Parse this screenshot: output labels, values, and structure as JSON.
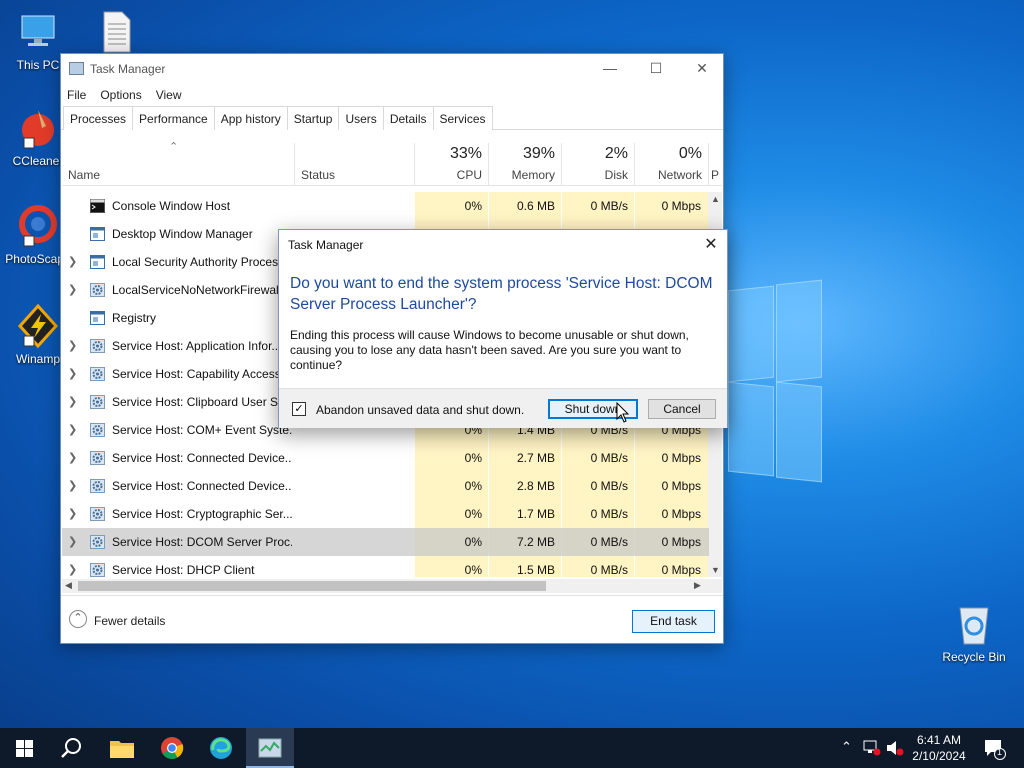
{
  "desktop": {
    "icons": [
      {
        "label": "This PC"
      },
      {
        "label": ""
      },
      {
        "label": "CCleaner"
      },
      {
        "label": "PhotoScape"
      },
      {
        "label": "Winamp"
      },
      {
        "label": "Recycle Bin"
      }
    ]
  },
  "task_manager": {
    "title": "Task Manager",
    "menu": [
      "File",
      "Options",
      "View"
    ],
    "tabs": [
      "Processes",
      "Performance",
      "App history",
      "Startup",
      "Users",
      "Details",
      "Services"
    ],
    "active_tab": "Processes",
    "columns": {
      "name": "Name",
      "status": "Status",
      "cpu": {
        "percent": "33%",
        "label": "CPU"
      },
      "memory": {
        "percent": "39%",
        "label": "Memory"
      },
      "disk": {
        "percent": "2%",
        "label": "Disk"
      },
      "network": {
        "percent": "0%",
        "label": "Network"
      },
      "power": "P"
    },
    "processes": [
      {
        "name": "Console Window Host",
        "cpu": "0%",
        "memory": "0.6 MB",
        "disk": "0 MB/s",
        "network": "0 Mbps",
        "expandable": false,
        "icon": "console-icon"
      },
      {
        "name": "Desktop Window Manager",
        "cpu": "",
        "memory": "",
        "disk": "",
        "network": "",
        "expandable": false,
        "icon": "window-icon"
      },
      {
        "name": "Local Security Authority Process",
        "cpu": "",
        "memory": "",
        "disk": "",
        "network": "",
        "expandable": true,
        "icon": "window-icon"
      },
      {
        "name": "LocalServiceNoNetworkFirewall",
        "cpu": "",
        "memory": "",
        "disk": "",
        "network": "",
        "expandable": true,
        "icon": "gear-icon"
      },
      {
        "name": "Registry",
        "cpu": "",
        "memory": "",
        "disk": "",
        "network": "",
        "expandable": false,
        "icon": "window-icon"
      },
      {
        "name": "Service Host: Application Infor...",
        "cpu": "",
        "memory": "",
        "disk": "",
        "network": "",
        "expandable": true,
        "icon": "gear-icon"
      },
      {
        "name": "Service Host: Capability Access",
        "cpu": "",
        "memory": "",
        "disk": "",
        "network": "",
        "expandable": true,
        "icon": "gear-icon"
      },
      {
        "name": "Service Host: Clipboard User Ser",
        "cpu": "",
        "memory": "",
        "disk": "",
        "network": "",
        "expandable": true,
        "icon": "gear-icon"
      },
      {
        "name": "Service Host: COM+ Event Syste...",
        "cpu": "0%",
        "memory": "1.4 MB",
        "disk": "0 MB/s",
        "network": "0 Mbps",
        "expandable": true,
        "icon": "gear-icon"
      },
      {
        "name": "Service Host: Connected Device...",
        "cpu": "0%",
        "memory": "2.7 MB",
        "disk": "0 MB/s",
        "network": "0 Mbps",
        "expandable": true,
        "icon": "gear-icon"
      },
      {
        "name": "Service Host: Connected Device...",
        "cpu": "0%",
        "memory": "2.8 MB",
        "disk": "0 MB/s",
        "network": "0 Mbps",
        "expandable": true,
        "icon": "gear-icon"
      },
      {
        "name": "Service Host: Cryptographic Ser...",
        "cpu": "0%",
        "memory": "1.7 MB",
        "disk": "0 MB/s",
        "network": "0 Mbps",
        "expandable": true,
        "icon": "gear-icon"
      },
      {
        "name": "Service Host: DCOM Server Proc...",
        "cpu": "0%",
        "memory": "7.2 MB",
        "disk": "0 MB/s",
        "network": "0 Mbps",
        "expandable": true,
        "icon": "gear-icon",
        "selected": true
      },
      {
        "name": "Service Host: DHCP Client",
        "cpu": "0%",
        "memory": "1.5 MB",
        "disk": "0 MB/s",
        "network": "0 Mbps",
        "expandable": true,
        "icon": "gear-icon"
      }
    ],
    "fewer_details": "Fewer details",
    "end_task": "End task"
  },
  "dialog": {
    "title": "Task Manager",
    "heading": "Do you want to end the system process 'Service Host: DCOM Server Process Launcher'?",
    "body": "Ending this process will cause Windows to become unusable or shut down, causing you to lose any data hasn't been saved. Are you sure you want to continue?",
    "checkbox_label": "Abandon unsaved data and shut down.",
    "checkbox_checked": true,
    "shutdown_label": "Shut down",
    "cancel_label": "Cancel"
  },
  "taskbar": {
    "time": "6:41 AM",
    "date": "2/10/2024",
    "notification_count": "1"
  },
  "colors": {
    "accent": "#0078d7",
    "heading_blue": "#1e4a9c",
    "heat_yellow": "#fff4c4",
    "selected_row": "#dadada"
  }
}
